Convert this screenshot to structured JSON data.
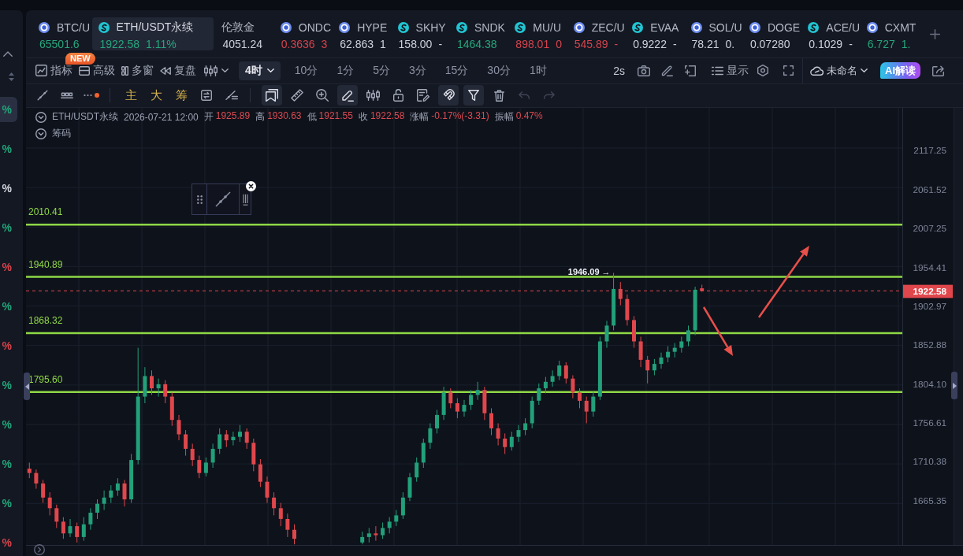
{
  "watchlist": {
    "rows": [
      {
        "text": "%",
        "color": "#22a57b",
        "selected": true
      },
      {
        "text": "%",
        "color": "#22a57b",
        "selected": false
      },
      {
        "text": "%",
        "color": "#d3d6df",
        "selected": false
      },
      {
        "text": "%",
        "color": "#22a57b",
        "selected": false
      },
      {
        "text": "%",
        "color": "#d6434c",
        "selected": false
      },
      {
        "text": "%",
        "color": "#22a57b",
        "selected": false
      },
      {
        "text": "%",
        "color": "#d6434c",
        "selected": false
      },
      {
        "text": "%",
        "color": "#22a57b",
        "selected": false
      },
      {
        "text": "%",
        "color": "#22a57b",
        "selected": false
      },
      {
        "text": "%",
        "color": "#22a57b",
        "selected": false
      },
      {
        "text": "%",
        "color": "#22a57b",
        "selected": false
      },
      {
        "text": "%",
        "color": "#d6434c",
        "selected": false
      }
    ]
  },
  "tickers": [
    {
      "kind": "ring",
      "symbol": "BTC/U",
      "price": "65501.6",
      "color": "#25a77c",
      "selected": false
    },
    {
      "kind": "swirl",
      "symbol": "ETH/USDT永续",
      "price": "1922.58",
      "change": "1.11%",
      "color": "#25a77c",
      "selected": true
    },
    {
      "kind": "plain",
      "symbol": "伦敦金",
      "price": "4051.24",
      "color": "#cdd1db",
      "selected": false
    },
    {
      "kind": "ring",
      "symbol": "ONDC",
      "price": "0.3636",
      "change": "3",
      "color": "#d6434c",
      "selected": false
    },
    {
      "kind": "ring",
      "symbol": "HYPE",
      "price": "62.863",
      "change": "1",
      "color": "#cdd1db",
      "selected": false
    },
    {
      "kind": "swirl",
      "symbol": "SKHY",
      "price": "158.00",
      "change": "-",
      "color": "#cdd1db",
      "selected": false
    },
    {
      "kind": "swirl",
      "symbol": "SNDK",
      "price": "1464.38",
      "color": "#25a77c",
      "selected": false
    },
    {
      "kind": "swirl",
      "symbol": "MU/U",
      "price": "898.01",
      "change": "0",
      "color": "#d6434c",
      "selected": false
    },
    {
      "kind": "ring",
      "symbol": "ZEC/U",
      "price": "545.89",
      "change": "-",
      "color": "#d6434c",
      "selected": false
    },
    {
      "kind": "swirl",
      "symbol": "EVAA",
      "price": "0.9222",
      "change": "-",
      "color": "#cdd1db",
      "selected": false
    },
    {
      "kind": "ring",
      "symbol": "SOL/U",
      "price": "78.21",
      "change": "0.",
      "color": "#cdd1db",
      "selected": false
    },
    {
      "kind": "ring",
      "symbol": "DOGE",
      "price": "0.07280",
      "color": "#cdd1db",
      "selected": false
    },
    {
      "kind": "swirl",
      "symbol": "ACE/U",
      "price": "0.1029",
      "change": "-",
      "color": "#cdd1db",
      "selected": false
    },
    {
      "kind": "ring",
      "symbol": "CXMT",
      "price": "6.727",
      "change": "1.",
      "color": "#25a77c",
      "selected": false
    }
  ],
  "toolbar": {
    "menus": [
      {
        "label": "指标",
        "badge": "NEW"
      },
      {
        "label": "高级"
      },
      {
        "label": "多窗"
      },
      {
        "label": "复盘"
      }
    ],
    "intervals": [
      {
        "label": "4时",
        "selected": true
      },
      {
        "label": "10分",
        "selected": false
      },
      {
        "label": "1分",
        "selected": false
      },
      {
        "label": "5分",
        "selected": false
      },
      {
        "label": "3分",
        "selected": false
      },
      {
        "label": "15分",
        "selected": false
      },
      {
        "label": "30分",
        "selected": false
      },
      {
        "label": "1时",
        "selected": false
      }
    ],
    "refresh_rate": "2s",
    "display_menu": "显示",
    "layout_menu": "未命名",
    "ai_button": "AI解读"
  },
  "drawing_tools": {
    "groups": [
      {
        "tools": [
          {
            "kind": "icon"
          },
          {
            "kind": "icon"
          },
          {
            "kind": "icon"
          }
        ]
      },
      {
        "tools": [
          {
            "kind": "text",
            "label": "主"
          },
          {
            "kind": "text",
            "label": "大"
          },
          {
            "kind": "text",
            "label": "筹"
          },
          {
            "kind": "icon"
          },
          {
            "kind": "icon"
          }
        ]
      },
      {
        "tools": [
          {
            "kind": "icon",
            "active": true,
            "disabled": false
          },
          {
            "kind": "icon",
            "active": false,
            "disabled": false
          },
          {
            "kind": "icon",
            "active": false,
            "disabled": false
          },
          {
            "kind": "icon",
            "active": true,
            "disabled": false
          },
          {
            "kind": "icon",
            "active": false,
            "disabled": false
          },
          {
            "kind": "icon",
            "active": false,
            "disabled": false
          },
          {
            "kind": "icon",
            "active": false,
            "disabled": false
          },
          {
            "kind": "icon",
            "active": true,
            "disabled": false
          },
          {
            "kind": "icon",
            "active": true,
            "disabled": false
          },
          {
            "kind": "icon",
            "active": false,
            "disabled": false
          },
          {
            "kind": "icon",
            "active": false,
            "disabled": true
          },
          {
            "kind": "icon",
            "active": false,
            "disabled": true
          }
        ]
      }
    ]
  },
  "chart": {
    "legend": {
      "symbol": "ETH/USDT永续",
      "time": "2026-07-21 12:00",
      "color": "#dc4a52",
      "fields": [
        {
          "label": "开",
          "value": "1925.89"
        },
        {
          "label": "高",
          "value": "1930.63"
        },
        {
          "label": "低",
          "value": "1921.55"
        },
        {
          "label": "收",
          "value": "1922.58"
        },
        {
          "label": "涨幅",
          "value": "-0.17%(-3.31)"
        },
        {
          "label": "振幅",
          "value": "0.47%"
        }
      ]
    },
    "indicator": "筹码",
    "chart_data": {
      "type": "candlestick",
      "log": true,
      "grid": true,
      "tick_labels": "y",
      "ylim": [
        1619.3,
        2175.5
      ],
      "yticks": [
        2117.25,
        2061.52,
        2007.25,
        1954.41,
        1902.97,
        1852.88,
        {
          "value": 1804.1,
          "label": "1804.10"
        },
        1756.61,
        1710.38,
        1665.35
      ],
      "ohlc": [
        [
          1705,
          1712,
          1694,
          1700
        ],
        [
          1700,
          1704,
          1682,
          1688
        ],
        [
          1688,
          1692,
          1666,
          1672
        ],
        [
          1672,
          1678,
          1652,
          1660
        ],
        [
          1660,
          1664,
          1638,
          1645
        ],
        [
          1645,
          1650,
          1626,
          1632
        ],
        [
          1632,
          1648,
          1628,
          1640
        ],
        [
          1640,
          1644,
          1622,
          1628
        ],
        [
          1628,
          1650,
          1624,
          1642
        ],
        [
          1642,
          1660,
          1636,
          1655
        ],
        [
          1655,
          1670,
          1648,
          1665
        ],
        [
          1665,
          1680,
          1658,
          1672
        ],
        [
          1672,
          1686,
          1666,
          1680
        ],
        [
          1680,
          1694,
          1674,
          1688
        ],
        [
          1688,
          1692,
          1662,
          1670
        ],
        [
          1670,
          1722,
          1666,
          1715
        ],
        [
          1715,
          1850,
          1710,
          1790
        ],
        [
          1790,
          1826,
          1782,
          1815
        ],
        [
          1815,
          1822,
          1792,
          1800
        ],
        [
          1800,
          1812,
          1790,
          1805
        ],
        [
          1805,
          1810,
          1782,
          1790
        ],
        [
          1790,
          1795,
          1755,
          1762
        ],
        [
          1762,
          1768,
          1738,
          1745
        ],
        [
          1745,
          1750,
          1720,
          1728
        ],
        [
          1728,
          1734,
          1708,
          1715
        ],
        [
          1715,
          1720,
          1694,
          1700
        ],
        [
          1700,
          1718,
          1696,
          1712
        ],
        [
          1712,
          1734,
          1706,
          1728
        ],
        [
          1728,
          1752,
          1722,
          1745
        ],
        [
          1745,
          1750,
          1730,
          1738
        ],
        [
          1738,
          1748,
          1732,
          1742
        ],
        [
          1742,
          1756,
          1736,
          1748
        ],
        [
          1748,
          1752,
          1728,
          1735
        ],
        [
          1735,
          1740,
          1702,
          1710
        ],
        [
          1710,
          1716,
          1684,
          1690
        ],
        [
          1690,
          1696,
          1666,
          1672
        ],
        [
          1672,
          1678,
          1652,
          1660
        ],
        [
          1660,
          1666,
          1640,
          1648
        ],
        [
          1648,
          1654,
          1628,
          1636
        ],
        [
          1636,
          1642,
          1620,
          1626
        ],
        null,
        null,
        null,
        null,
        null,
        null,
        null,
        null,
        null,
        [
          1622,
          1634,
          1620,
          1628
        ],
        [
          1628,
          1638,
          1622,
          1632
        ],
        [
          1632,
          1640,
          1624,
          1630
        ],
        [
          1630,
          1644,
          1626,
          1638
        ],
        [
          1638,
          1650,
          1632,
          1645
        ],
        [
          1645,
          1658,
          1640,
          1652
        ],
        [
          1652,
          1678,
          1648,
          1672
        ],
        [
          1672,
          1700,
          1668,
          1695
        ],
        [
          1695,
          1718,
          1690,
          1712
        ],
        [
          1712,
          1740,
          1706,
          1735
        ],
        [
          1735,
          1758,
          1728,
          1752
        ],
        [
          1752,
          1774,
          1746,
          1768
        ],
        [
          1768,
          1802,
          1762,
          1795
        ],
        [
          1795,
          1800,
          1776,
          1782
        ],
        [
          1782,
          1788,
          1764,
          1772
        ],
        [
          1772,
          1786,
          1766,
          1780
        ],
        [
          1780,
          1798,
          1774,
          1792
        ],
        [
          1792,
          1808,
          1786,
          1798
        ],
        [
          1798,
          1802,
          1762,
          1770
        ],
        [
          1770,
          1776,
          1744,
          1752
        ],
        [
          1752,
          1758,
          1732,
          1740
        ],
        [
          1740,
          1746,
          1722,
          1730
        ],
        [
          1730,
          1748,
          1726,
          1742
        ],
        [
          1742,
          1756,
          1736,
          1750
        ],
        [
          1750,
          1764,
          1744,
          1758
        ],
        [
          1758,
          1790,
          1752,
          1785
        ],
        [
          1785,
          1806,
          1780,
          1800
        ],
        [
          1800,
          1814,
          1794,
          1808
        ],
        [
          1808,
          1822,
          1802,
          1815
        ],
        [
          1815,
          1834,
          1810,
          1828
        ],
        [
          1828,
          1832,
          1806,
          1812
        ],
        [
          1812,
          1816,
          1788,
          1795
        ],
        [
          1795,
          1800,
          1776,
          1785
        ],
        [
          1785,
          1790,
          1758,
          1772
        ],
        [
          1772,
          1796,
          1766,
          1790
        ],
        [
          1790,
          1864,
          1786,
          1858
        ],
        [
          1858,
          1884,
          1850,
          1878
        ],
        [
          1878,
          1946.09,
          1872,
          1925
        ],
        [
          1925,
          1934,
          1904,
          1912
        ],
        [
          1912,
          1918,
          1878,
          1885
        ],
        [
          1885,
          1890,
          1850,
          1858
        ],
        [
          1858,
          1864,
          1826,
          1835
        ],
        [
          1835,
          1840,
          1806,
          1822
        ],
        [
          1822,
          1836,
          1816,
          1830
        ],
        [
          1830,
          1844,
          1824,
          1838
        ],
        [
          1838,
          1852,
          1832,
          1845
        ],
        [
          1845,
          1856,
          1838,
          1850
        ],
        [
          1850,
          1864,
          1844,
          1858
        ],
        [
          1858,
          1878,
          1852,
          1872
        ],
        [
          1872,
          1928,
          1866,
          1924
        ],
        [
          1925.89,
          1930.63,
          1921.55,
          1922.58
        ],
        null,
        null,
        null,
        null,
        null,
        null,
        null,
        null,
        null,
        null,
        null,
        null,
        null,
        null,
        null,
        null,
        null,
        null,
        null,
        null,
        null,
        null,
        null,
        null,
        null,
        null,
        null,
        null,
        null
      ],
      "ref_lines": [
        {
          "axis": "y",
          "value": 2010.41,
          "label": "2010.41",
          "color": "#8fd846",
          "line_style": "solid"
        },
        {
          "axis": "y",
          "value": 1940.89,
          "label": "1940.89",
          "color": "#8fd846",
          "line_style": "solid"
        },
        {
          "axis": "y",
          "value": 1868.32,
          "label": "1868.32",
          "color": "#8fd846",
          "line_style": "solid"
        },
        {
          "axis": "y",
          "value": 1795.6,
          "label": "1795.60",
          "color": "#8fd846",
          "line_style": "solid"
        },
        {
          "axis": "y",
          "value": 1922.58,
          "label": "1922.58",
          "color": "#e0474c",
          "line_style": "dashed"
        }
      ],
      "annotations": [
        "1946.09 →"
      ]
    }
  }
}
